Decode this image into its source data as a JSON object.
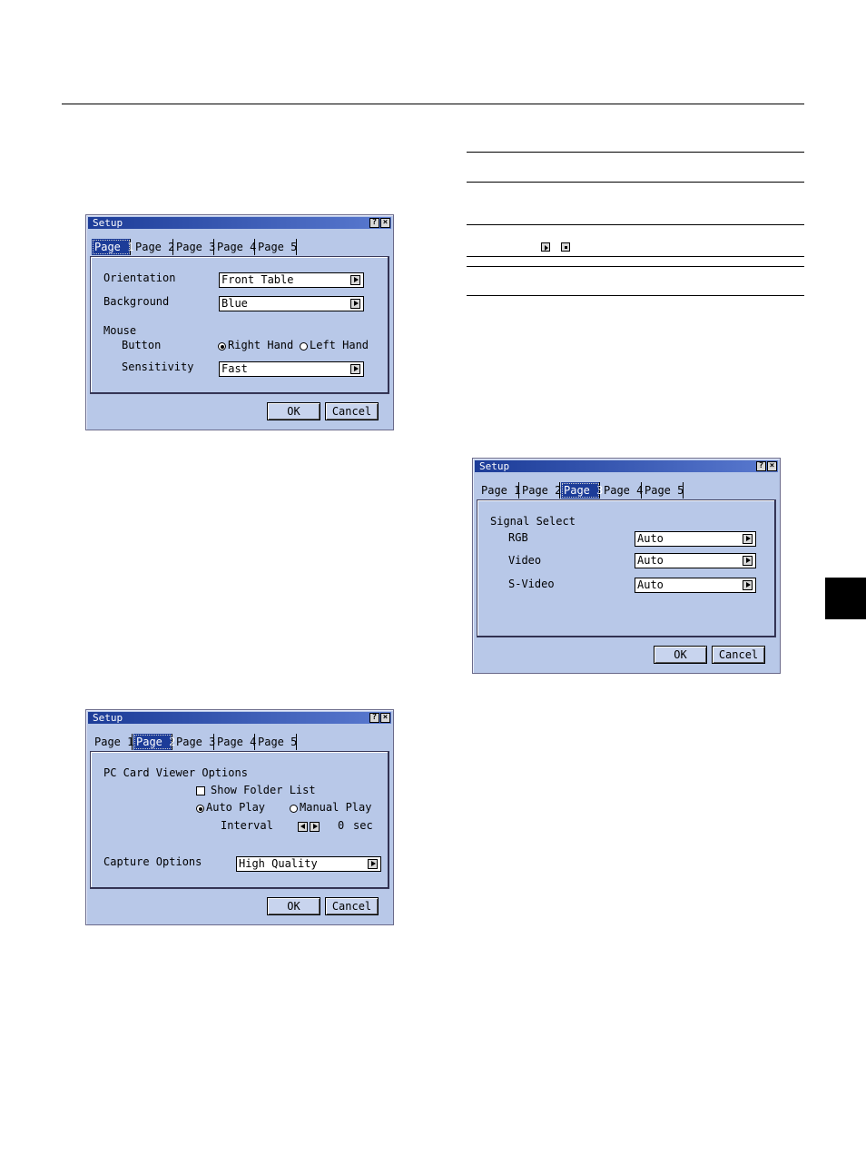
{
  "dialog1": {
    "title": "Setup",
    "tabs": [
      "Page 1",
      "Page 2",
      "Page 3",
      "Page 4",
      "Page 5"
    ],
    "active_tab": 0,
    "orientation_label": "Orientation",
    "orientation_value": "Front Table",
    "background_label": "Background",
    "background_value": "Blue",
    "mouse_label": "Mouse",
    "button_label": "Button",
    "right_hand": "Right Hand",
    "left_hand": "Left Hand",
    "sensitivity_label": "Sensitivity",
    "sensitivity_value": "Fast",
    "ok": "OK",
    "cancel": "Cancel"
  },
  "dialog2": {
    "title": "Setup",
    "tabs": [
      "Page 1",
      "Page 2",
      "Page 3",
      "Page 4",
      "Page 5"
    ],
    "active_tab": 1,
    "pc_card_label": "PC Card Viewer Options",
    "show_folder": "Show Folder List",
    "auto_play": "Auto Play",
    "manual_play": "Manual Play",
    "interval_label": "Interval",
    "interval_value": "0",
    "interval_unit": "sec",
    "capture_label": "Capture Options",
    "capture_value": "High Quality",
    "ok": "OK",
    "cancel": "Cancel"
  },
  "dialog3": {
    "title": "Setup",
    "tabs": [
      "Page 1",
      "Page 2",
      "Page 3",
      "Page 4",
      "Page 5"
    ],
    "active_tab": 2,
    "signal_label": "Signal Select",
    "rgb_label": "RGB",
    "rgb_value": "Auto",
    "video_label": "Video",
    "video_value": "Auto",
    "svideo_label": "S-Video",
    "svideo_value": "Auto",
    "ok": "OK",
    "cancel": "Cancel"
  },
  "colors": {
    "titlebar": "#1c3c98",
    "window": "#b8c8e8",
    "tab_marker": "#000000"
  },
  "icons": [
    "help-icon",
    "close-icon",
    "dropdown-arrow-icon",
    "play-icon",
    "stop-icon"
  ]
}
